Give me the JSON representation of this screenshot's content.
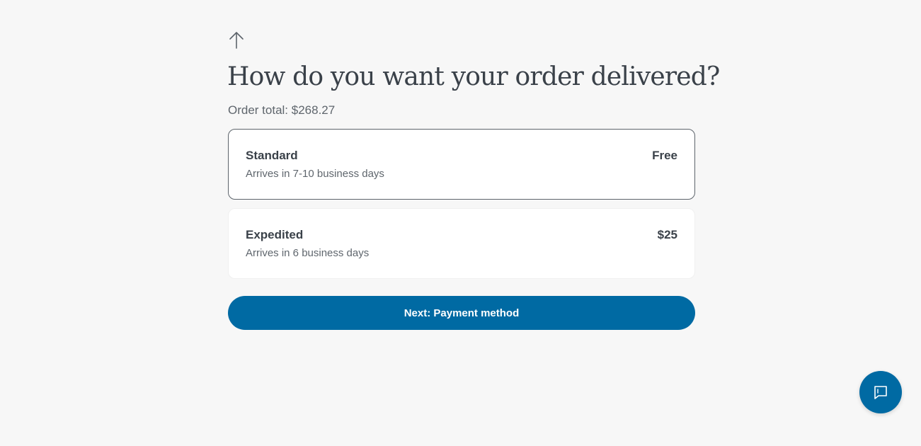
{
  "header": {
    "back_icon": "arrow-up-icon",
    "title": "How do you want your order delivered?",
    "order_total": "Order total: $268.27"
  },
  "delivery_options": [
    {
      "name": "Standard",
      "description": "Arrives in 7-10 business days",
      "price": "Free",
      "selected": true
    },
    {
      "name": "Expedited",
      "description": "Arrives in 6 business days",
      "price": "$25",
      "selected": false
    }
  ],
  "actions": {
    "next_label": "Next: Payment method"
  },
  "chat": {
    "icon": "chat-icon"
  },
  "colors": {
    "primary": "#006aa3",
    "background": "#f7f7f7",
    "text": "#3a4149",
    "muted_text": "#5f666d",
    "selected_border": "#5d646b"
  }
}
